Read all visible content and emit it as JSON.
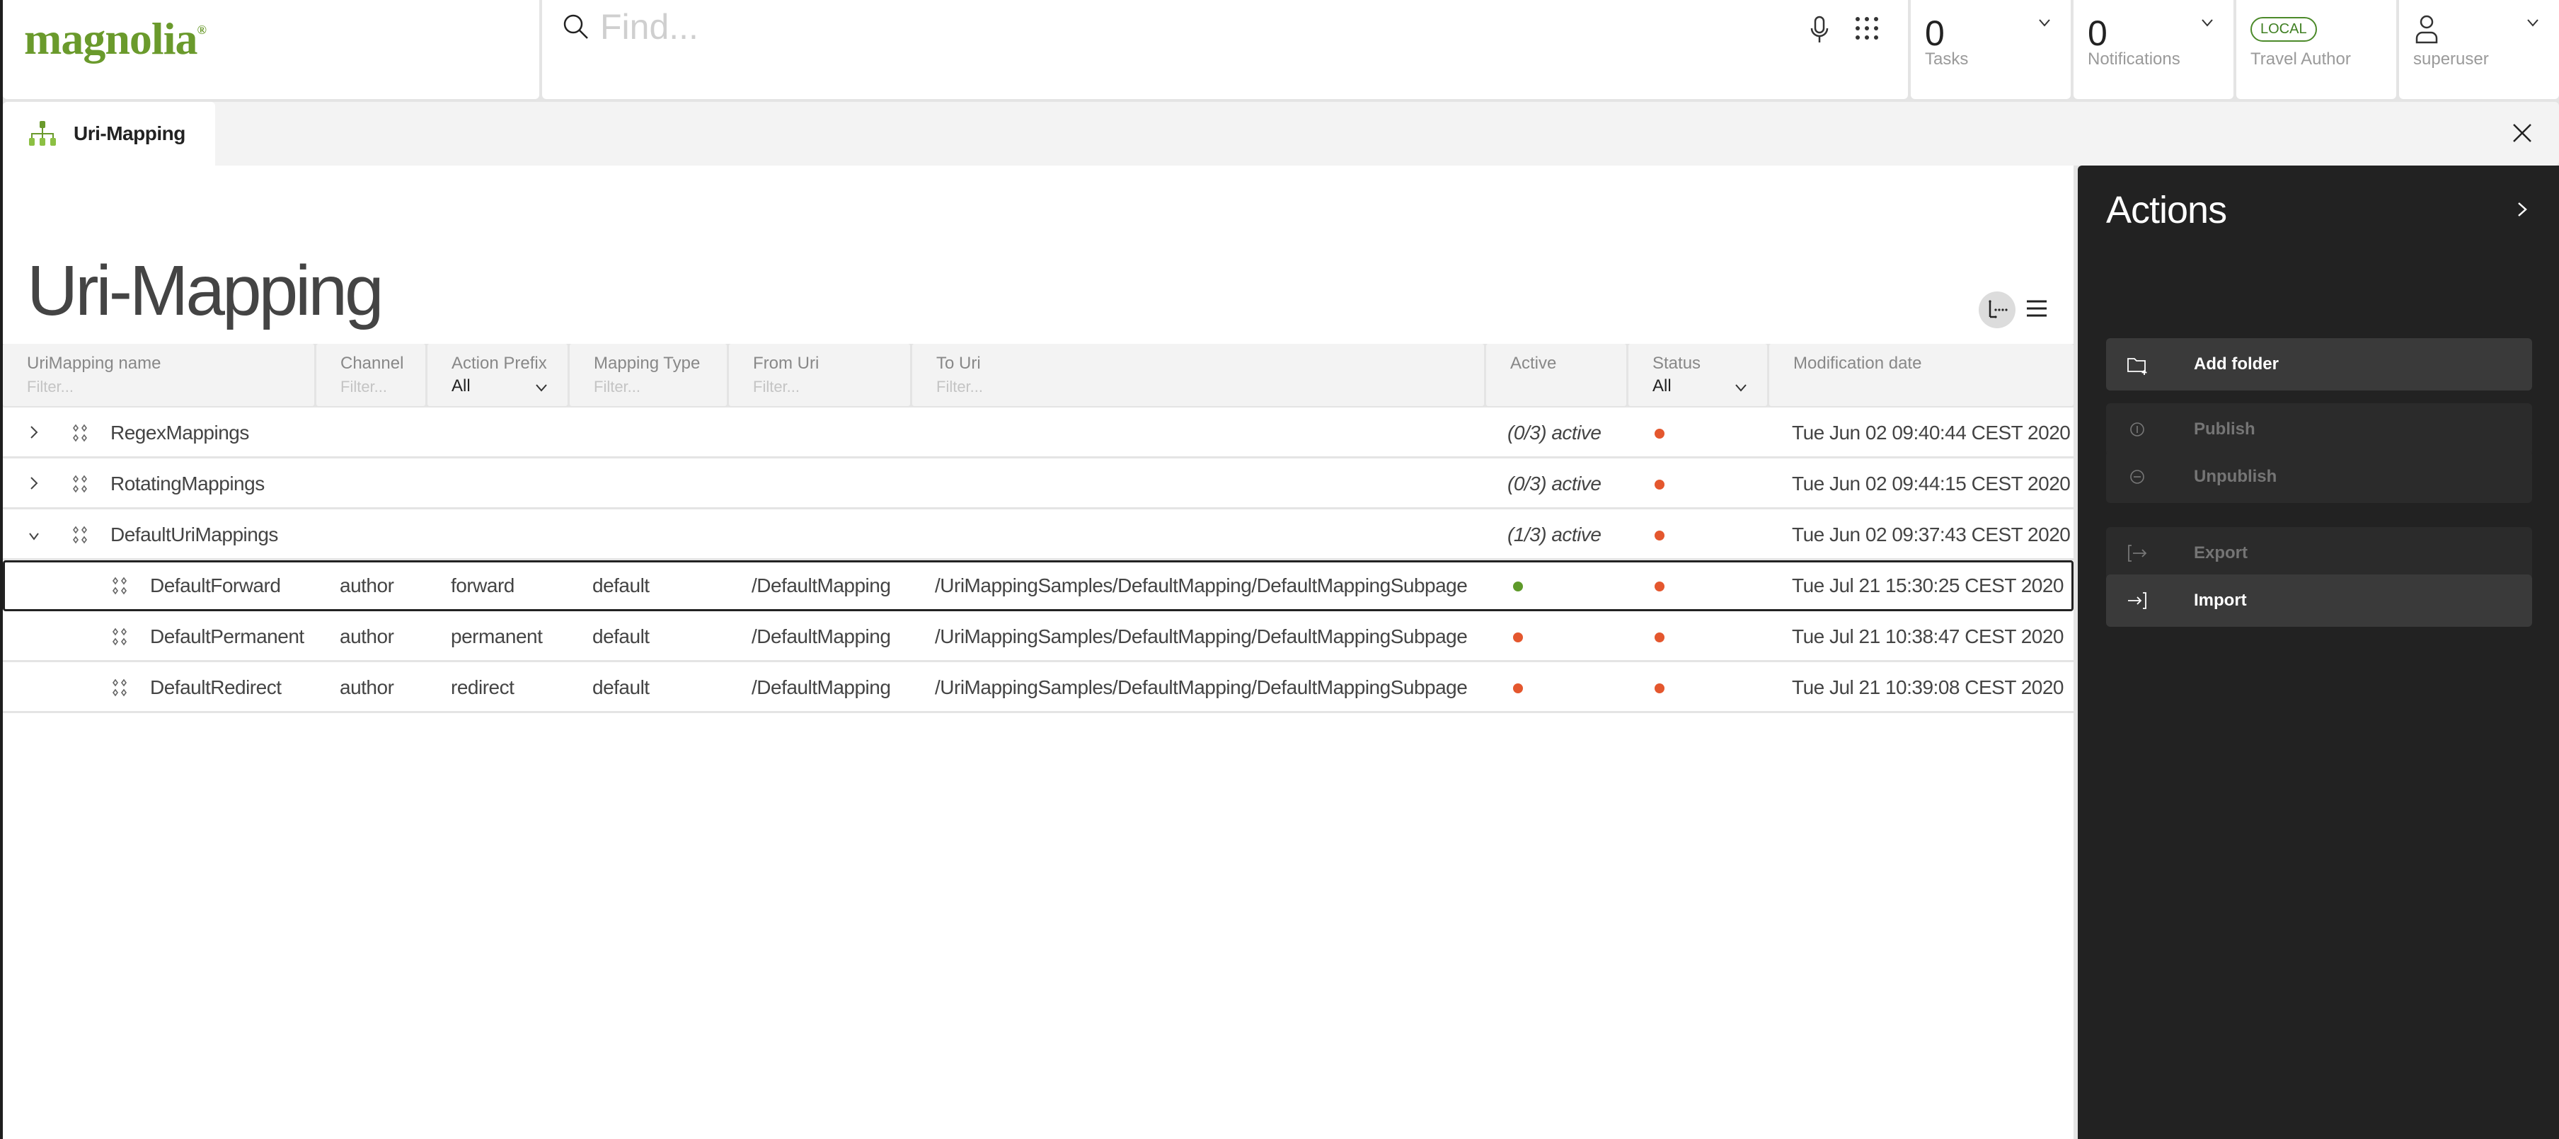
{
  "app": {
    "logo_text": "magnolia",
    "logo_mark": "®",
    "brand_color": "#6a9a2c"
  },
  "search": {
    "placeholder": "Find...",
    "value": ""
  },
  "topbar": {
    "tasks": {
      "count": "0",
      "label": "Tasks"
    },
    "notifications": {
      "count": "0",
      "label": "Notifications"
    },
    "environment": {
      "badge": "LOCAL",
      "label": "Travel Author"
    },
    "user": {
      "label": "superuser"
    }
  },
  "tab": {
    "label": "Uri-Mapping"
  },
  "page": {
    "title": "Uri-Mapping"
  },
  "grid": {
    "columns": [
      {
        "label": "UriMapping name",
        "filter_placeholder": "Filter..."
      },
      {
        "label": "Channel",
        "filter_placeholder": "Filter..."
      },
      {
        "label": "Action Prefix",
        "select_value": "All"
      },
      {
        "label": "Mapping Type",
        "filter_placeholder": "Filter..."
      },
      {
        "label": "From Uri",
        "filter_placeholder": "Filter..."
      },
      {
        "label": "To Uri",
        "filter_placeholder": "Filter..."
      },
      {
        "label": "Active"
      },
      {
        "label": "Status",
        "select_value": "All"
      },
      {
        "label": "Modification date"
      }
    ],
    "rows": [
      {
        "name": "RegexMappings",
        "type": "folder",
        "expanded": false,
        "channel": "",
        "action_prefix": "",
        "mapping_type": "",
        "from_uri": "",
        "to_uri": "",
        "active": "(0/3) active",
        "status": "unpublished",
        "modified": "Tue Jun 02 09:40:44 CEST 2020"
      },
      {
        "name": "RotatingMappings",
        "type": "folder",
        "expanded": false,
        "channel": "",
        "action_prefix": "",
        "mapping_type": "",
        "from_uri": "",
        "to_uri": "",
        "active": "(0/3) active",
        "status": "unpublished",
        "modified": "Tue Jun 02 09:44:15 CEST 2020"
      },
      {
        "name": "DefaultUriMappings",
        "type": "folder",
        "expanded": true,
        "channel": "",
        "action_prefix": "",
        "mapping_type": "",
        "from_uri": "",
        "to_uri": "",
        "active": "(1/3) active",
        "status": "unpublished",
        "modified": "Tue Jun 02 09:37:43 CEST 2020"
      },
      {
        "name": "DefaultForward",
        "type": "item",
        "selected": true,
        "channel": "author",
        "action_prefix": "forward",
        "mapping_type": "default",
        "from_uri": "/DefaultMapping",
        "to_uri": "/UriMappingSamples/DefaultMapping/DefaultMappingSubpage",
        "active": "active",
        "status": "unpublished",
        "modified": "Tue Jul 21 15:30:25 CEST 2020"
      },
      {
        "name": "DefaultPermanent",
        "type": "item",
        "channel": "author",
        "action_prefix": "permanent",
        "mapping_type": "default",
        "from_uri": "/DefaultMapping",
        "to_uri": "/UriMappingSamples/DefaultMapping/DefaultMappingSubpage",
        "active": "inactive",
        "status": "unpublished",
        "modified": "Tue Jul 21 10:38:47 CEST 2020"
      },
      {
        "name": "DefaultRedirect",
        "type": "item",
        "channel": "author",
        "action_prefix": "redirect",
        "mapping_type": "default",
        "from_uri": "/DefaultMapping",
        "to_uri": "/UriMappingSamples/DefaultMapping/DefaultMappingSubpage",
        "active": "inactive",
        "status": "unpublished",
        "modified": "Tue Jul 21 10:39:08 CEST 2020"
      }
    ],
    "status_colors": {
      "active": "#5e9a2a",
      "inactive": "#e4572e",
      "unpublished": "#e4572e"
    }
  },
  "actions": {
    "title": "Actions",
    "items": [
      {
        "label": "Add folder",
        "icon": "folder-add-icon",
        "enabled": true
      },
      {
        "label": "Publish",
        "icon": "publish-icon",
        "enabled": false
      },
      {
        "label": "Unpublish",
        "icon": "unpublish-icon",
        "enabled": false
      },
      {
        "label": "Export",
        "icon": "export-icon",
        "enabled": false
      },
      {
        "label": "Import",
        "icon": "import-icon",
        "enabled": true
      }
    ]
  }
}
